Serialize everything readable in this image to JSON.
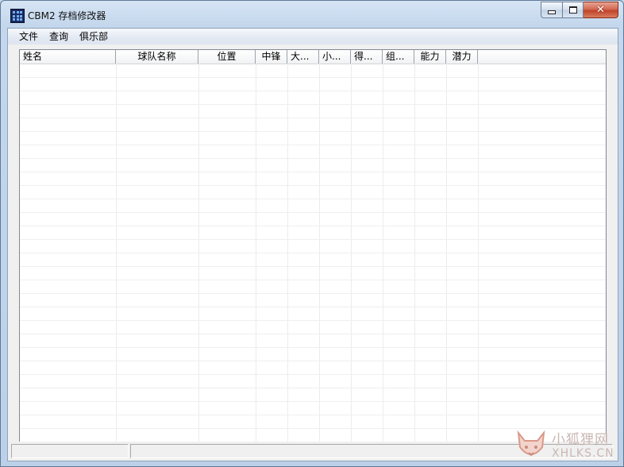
{
  "window": {
    "title": "CBM2 存档修改器"
  },
  "caption_buttons": {
    "minimize": "minimize-icon",
    "maximize": "maximize-icon",
    "close": "close-icon"
  },
  "menu": {
    "items": [
      "文件",
      "查询",
      "俱乐部"
    ]
  },
  "table": {
    "columns": [
      "姓名",
      "球队名称",
      "位置",
      "中锋",
      "大...",
      "小...",
      "得...",
      "组...",
      "能力",
      "潜力"
    ],
    "rows": []
  },
  "watermark": {
    "line1": "小狐狸网",
    "line2": "XHLKS.CN",
    "icon": "fox-logo-icon"
  }
}
